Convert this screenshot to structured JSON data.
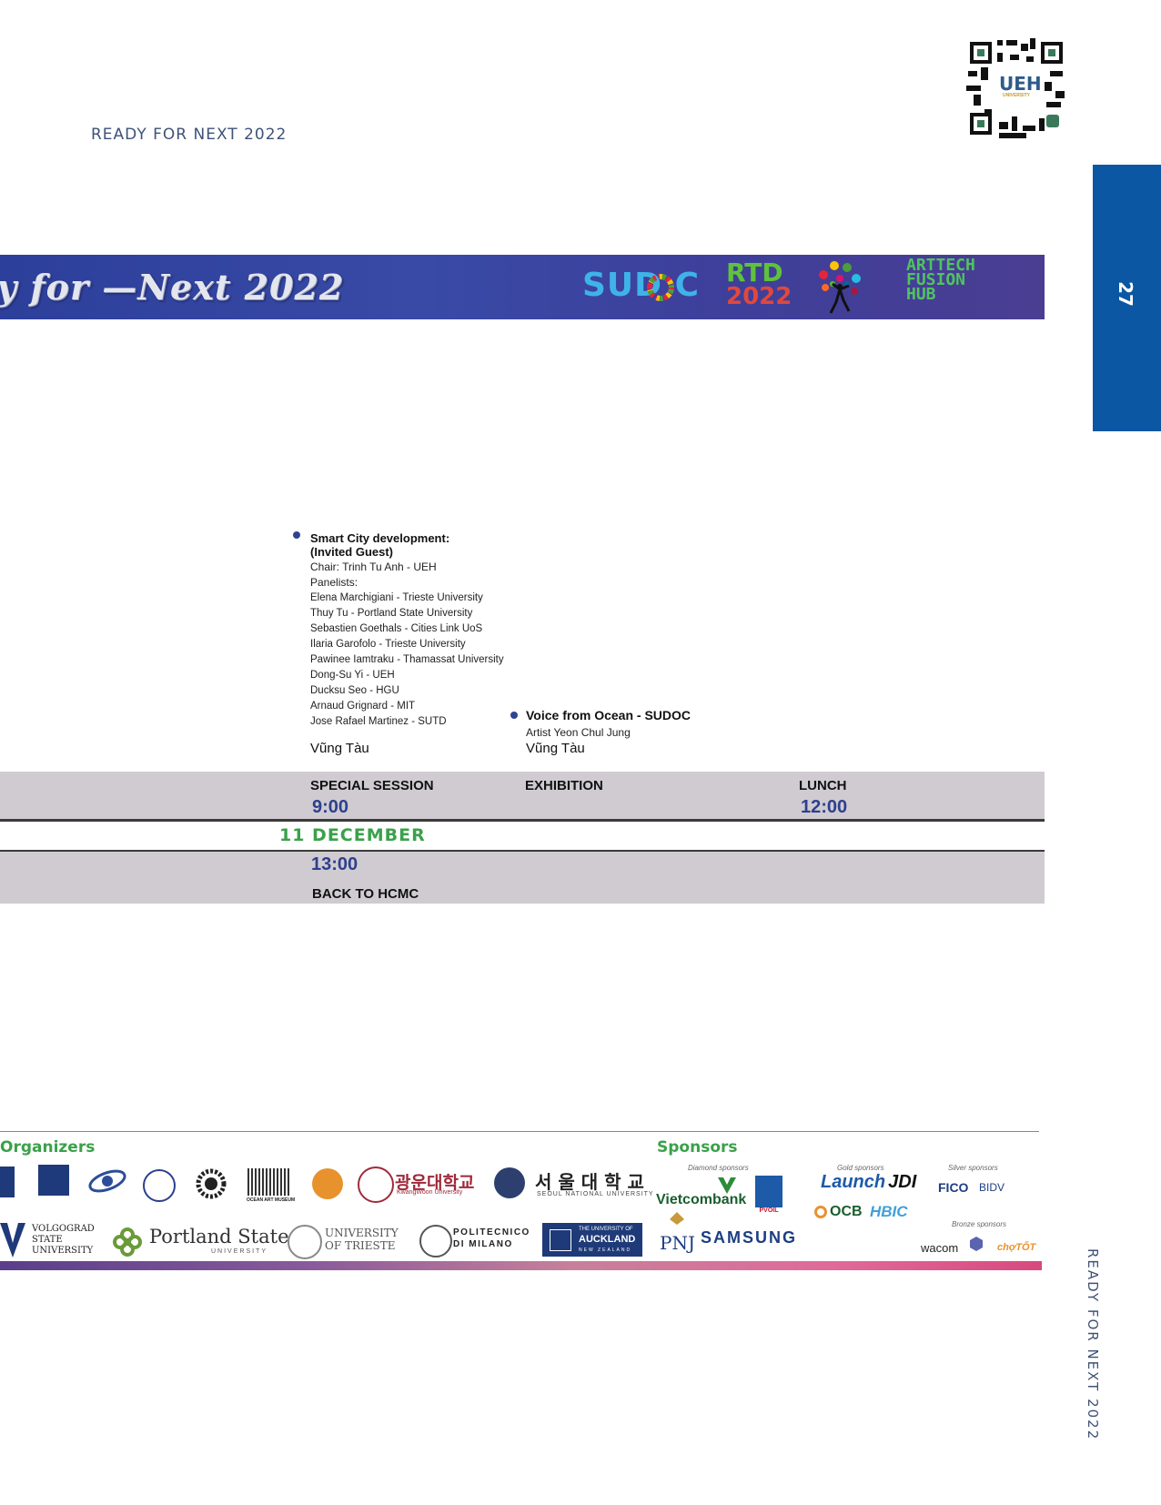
{
  "header": {
    "title": "READY FOR NEXT 2022"
  },
  "page_number": "27",
  "side_vertical_text": "READY FOR NEXT 2022",
  "banner": {
    "title": "y for —Next 2022",
    "logos": {
      "sudoc": "SUD C",
      "rtd_top": "RTD",
      "rtd_bottom": "2022",
      "arttech": [
        "ARTTECH",
        "FUSION",
        "HUB"
      ]
    }
  },
  "qr": {
    "label": "UEH",
    "sublabel": "UNIVERSITY"
  },
  "sessions": {
    "smart_city": {
      "title": "Smart City development:",
      "subtitle": "(Invited Guest)",
      "chair": "Chair: Trinh Tu Anh - UEH",
      "panelists_label": "Panelists:",
      "panelists": [
        "Elena Marchigiani - Trieste University",
        "Thuy Tu - Portland State University",
        "Sebastien Goethals - Cities Link UoS",
        "Ilaria Garofolo - Trieste University",
        "Pawinee Iamtraku - Thamassat University",
        "Dong-Su Yi - UEH",
        "Ducksu Seo - HGU",
        "Arnaud Grignard - MIT",
        "Jose Rafael Martinez - SUTD"
      ],
      "place": "Vũng Tàu"
    },
    "voice_ocean": {
      "title": "Voice from Ocean - SUDOC",
      "artist": "Artist Yeon Chul Jung",
      "place": "Vũng Tàu"
    }
  },
  "schedule": {
    "row1": {
      "special": "SPECIAL SESSION",
      "special_time": "9:00",
      "exhibition": "EXHIBITION",
      "lunch": "LUNCH",
      "lunch_time": "12:00"
    },
    "date": "11 DECEMBER",
    "row2": {
      "time": "13:00",
      "label": "BACK TO HCMC"
    }
  },
  "footer": {
    "organizers_label": "Organizers",
    "sponsors_label": "Sponsors",
    "organizers_row1": [
      "광운대학교",
      "KwangWoon University",
      "서 울 대 학 교",
      "SEOUL NATIONAL UNIVERSITY",
      "OCEAN ART MUSEUM"
    ],
    "organizers_row2": [
      "VOLGOGRAD",
      "STATE",
      "UNIVERSITY",
      "Portland State",
      "UNIVERSITY",
      "UNIVERSITY",
      "OF TRIESTE",
      "POLITECNICO",
      "DI MILANO",
      "THE UNIVERSITY OF",
      "AUCKLAND",
      "NEW ZEALAND"
    ],
    "sponsor_tiers": {
      "diamond": "Diamond sponsors",
      "gold": "Gold sponsors",
      "silver": "Silver sponsors",
      "bronze": "Bronze sponsors"
    },
    "sponsors": {
      "vietcombank": "Vietcombank",
      "pvoil": "PVOIL",
      "pnj": "PNJ",
      "samsung": "SAMSUNG",
      "launch": "Launch",
      "jdi": "JDI",
      "ocb": "OCB",
      "hbic": "HBIC",
      "fico": "FICO",
      "bidv": "BIDV",
      "wacom": "wacom",
      "chotot": "chợTỐT"
    }
  },
  "colors": {
    "accent_blue": "#0b57a4",
    "date_green": "#3aa14a",
    "time_blue": "#2e3f8e",
    "band_gray": "#cfcbd1"
  }
}
